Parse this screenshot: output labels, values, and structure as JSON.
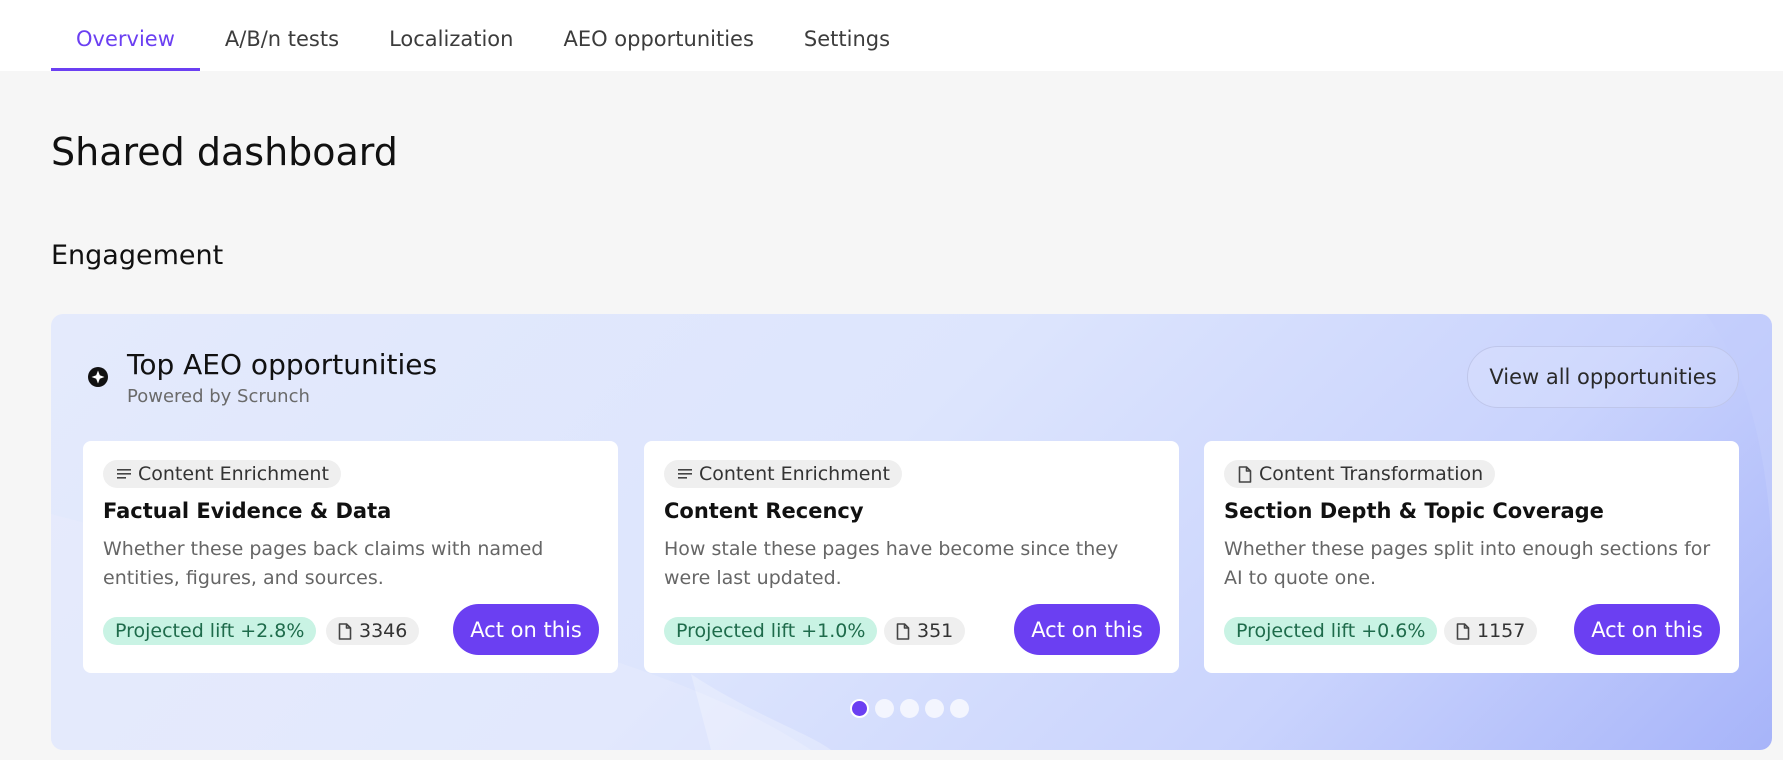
{
  "tabs": [
    {
      "label": "Overview",
      "active": true
    },
    {
      "label": "A/B/n tests",
      "active": false
    },
    {
      "label": "Localization",
      "active": false
    },
    {
      "label": "AEO opportunities",
      "active": false
    },
    {
      "label": "Settings",
      "active": false
    }
  ],
  "page_title": "Shared dashboard",
  "section_title": "Engagement",
  "panel": {
    "icon": "sparkle-badge-icon",
    "title": "Top AEO opportunities",
    "subtitle": "Powered by Scrunch",
    "view_all_label": "View all opportunities",
    "cards": [
      {
        "category_icon": "lines-icon",
        "category": "Content Enrichment",
        "title": "Factual Evidence & Data",
        "description": "Whether these pages back claims with named entities, figures, and sources.",
        "lift": "Projected lift +2.8%",
        "pages_icon": "document-icon",
        "pages_count": "3346",
        "action_label": "Act on this"
      },
      {
        "category_icon": "lines-icon",
        "category": "Content Enrichment",
        "title": "Content Recency",
        "description": "How stale these pages have become since they were last updated.",
        "lift": "Projected lift +1.0%",
        "pages_icon": "document-icon",
        "pages_count": "351",
        "action_label": "Act on this"
      },
      {
        "category_icon": "document-icon",
        "category": "Content Transformation",
        "title": "Section Depth & Topic Coverage",
        "description": "Whether these pages split into enough sections for AI to quote one.",
        "lift": "Projected lift +0.6%",
        "pages_icon": "document-icon",
        "pages_count": "1157",
        "action_label": "Act on this"
      }
    ],
    "pagination": {
      "current": 1,
      "total": 5
    }
  },
  "colors": {
    "accent": "#6b3ff2",
    "lift_bg": "#c9f3e4",
    "lift_text": "#1e6b4b",
    "panel_start": "#e4eafc",
    "panel_end": "#a7b4f9"
  }
}
